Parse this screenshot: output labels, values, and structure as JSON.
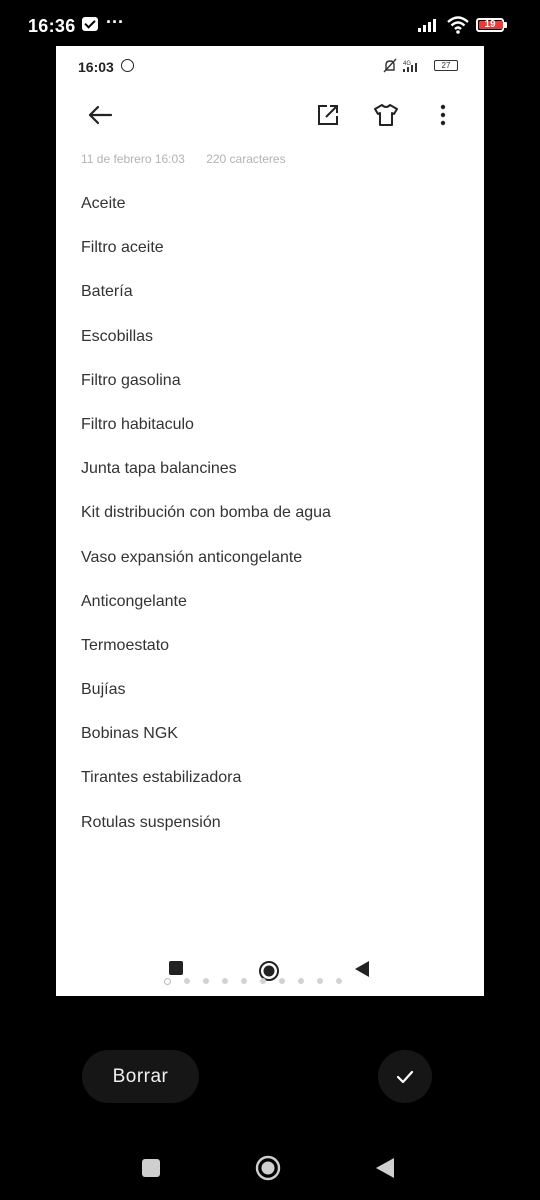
{
  "outer_status": {
    "time": "16:36",
    "more": "···",
    "battery": "19"
  },
  "inner_status": {
    "time": "16:03",
    "battery": "27",
    "network": "4G"
  },
  "note": {
    "date": "11 de febrero 16:03",
    "char_count": "220 caracteres",
    "items": [
      "Aceite",
      "Filtro aceite",
      "Batería",
      "Escobillas",
      "Filtro gasolina",
      "Filtro habitaculo",
      "Junta tapa balancines",
      "Kit distribución con bomba de agua",
      "Vaso expansión anticongelante",
      "Anticongelante",
      "Termoestato",
      "Bujías",
      "Bobinas NGK",
      "Tirantes estabilizadora",
      "Rotulas suspensión"
    ]
  },
  "actions": {
    "delete_label": "Borrar"
  },
  "colors": {
    "background": "#000000",
    "battery_low": "#e63b3b",
    "button_bg": "#161616"
  }
}
